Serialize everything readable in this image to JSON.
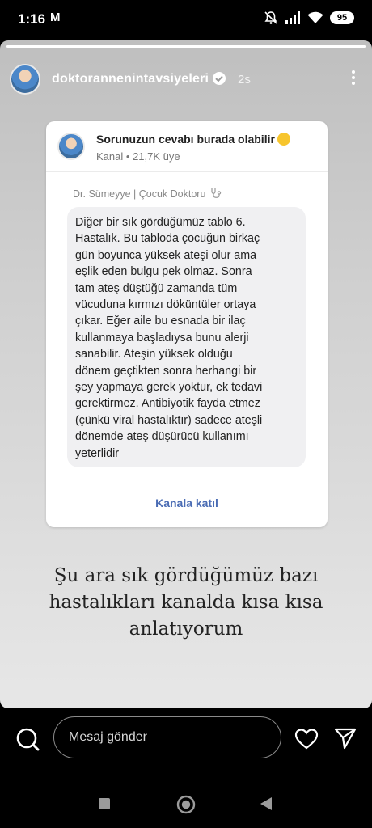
{
  "status_bar": {
    "time": "1:16",
    "mail_indicator": "M",
    "battery": "95",
    "icons": [
      "gmail-icon",
      "mute-icon",
      "signal-icon",
      "wifi-icon",
      "battery-icon"
    ]
  },
  "story": {
    "progress": 1.0,
    "username": "doktorannenintavsiyeleri",
    "time_ago": "2s",
    "background_gradient": [
      "#bfbfbf",
      "#e7e7e7"
    ]
  },
  "card": {
    "channel_name": "Sorunuzun cevabı burada olabilir",
    "channel_type": "Kanal",
    "separator": "•",
    "members": "21,7K üye",
    "sender": "Dr. Sümeyye | Çocuk Doktoru",
    "message": "Diğer bir sık gördüğümüz tablo 6.\nHastalık. Bu tabloda çocuğun birkaç\ngün boyunca yüksek ateşi olur ama\neşlik eden bulgu pek olmaz. Sonra\ntam ateş düştüğü zamanda tüm\nvücuduna kırmızı döküntüler ortaya\nçıkar. Eğer aile bu esnada bir ilaç\nkullanmaya başladıysa bunu alerji\nsanabilir. Ateşin yüksek olduğu\ndönem geçtikten sonra herhangi bir\nşey yapmaya gerek yoktur, ek tedavi\ngerektirmez. Antibiyotik fayda etmez\n(çünkü viral hastalıktır) sadece ateşli\ndönemde ateş düşürücü kullanımı\nyeterlidir",
    "join_label": "Kanala katıl",
    "link_color": "#4a6cb4"
  },
  "caption": "Şu ara sık gördüğümüz bazı\nhastalıkları kanalda kısa kısa\nanlatıyorum",
  "reply_bar": {
    "placeholder": "Mesaj gönder",
    "icons": [
      "camera-icon",
      "heart-icon",
      "send-icon"
    ]
  },
  "nav_bar": {
    "icons": [
      "recents-icon",
      "home-icon",
      "back-icon"
    ]
  }
}
